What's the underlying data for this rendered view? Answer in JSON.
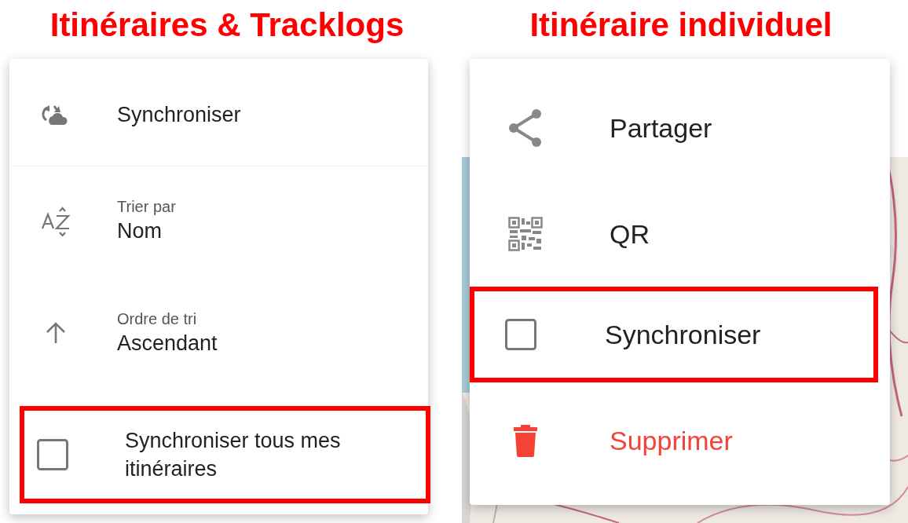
{
  "panels": [
    {
      "title": "Itinéraires & Tracklogs",
      "items": [
        {
          "kind": "sync",
          "label": "Synchroniser",
          "highlighted": false
        },
        {
          "kind": "sortfield",
          "caption": "Trier par",
          "label": "Nom",
          "highlighted": false
        },
        {
          "kind": "sortorder",
          "caption": "Ordre de tri",
          "label": "Ascendant",
          "highlighted": false
        },
        {
          "kind": "checkbox",
          "label": "Synchroniser tous mes itinéraires",
          "checked": false,
          "highlighted": true
        }
      ]
    },
    {
      "title": "Itinéraire individuel",
      "items": [
        {
          "kind": "share",
          "label": "Partager",
          "highlighted": false
        },
        {
          "kind": "qr",
          "label": "QR",
          "highlighted": false
        },
        {
          "kind": "checkbox",
          "label": "Synchroniser",
          "checked": false,
          "highlighted": true
        },
        {
          "kind": "delete",
          "label": "Supprimer",
          "highlighted": false
        }
      ]
    }
  ]
}
